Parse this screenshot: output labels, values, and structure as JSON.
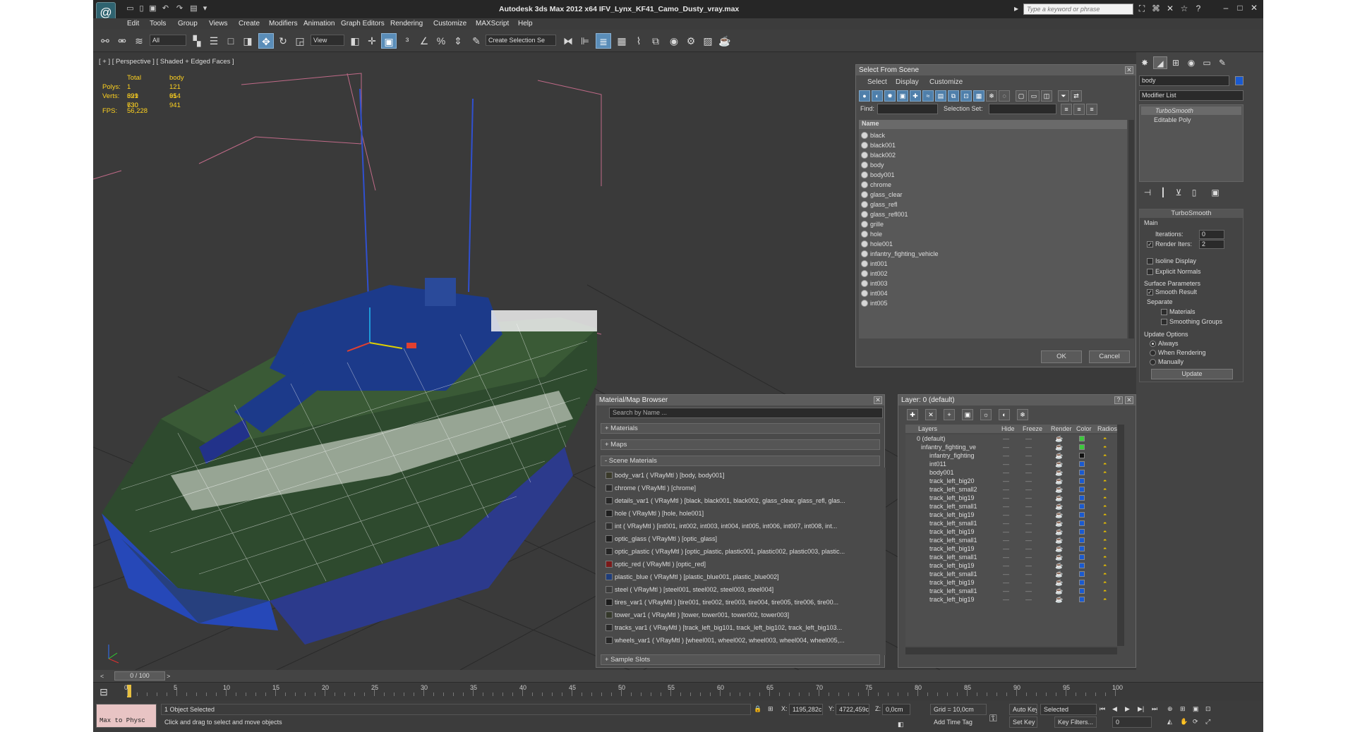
{
  "app": {
    "title": "Autodesk 3ds Max  2012 x64      IFV_Lynx_KF41_Camo_Dusty_vray.max",
    "search_placeholder": "Type a keyword or phrase",
    "logo_glyph": "@"
  },
  "menu": [
    "Edit",
    "Tools",
    "Group",
    "Views",
    "Create",
    "Modifiers",
    "Animation",
    "Graph Editors",
    "Rendering",
    "Customize",
    "MAXScript",
    "Help"
  ],
  "toolbar": {
    "filter": "All",
    "coord": "View",
    "selection_set": "Create Selection Se"
  },
  "viewport": {
    "label": "[ + ] [ Perspective ] [ Shaded + Edged Faces ]",
    "stats": {
      "header_total": "Total",
      "header_obj": "body",
      "polys_label": "Polys:",
      "polys_total": "1 321 630",
      "polys_obj": "121 914",
      "verts_label": "Verts:",
      "verts_total": "699 730",
      "verts_obj": "65 941",
      "fps_label": "FPS:",
      "fps_value": "56,228"
    }
  },
  "select_from_scene": {
    "title": "Select From Scene",
    "menu": [
      "Select",
      "Display",
      "Customize"
    ],
    "find_label": "Find:",
    "selection_set_label": "Selection Set:",
    "column": "Name",
    "items": [
      "black",
      "black001",
      "black002",
      "body",
      "body001",
      "chrome",
      "glass_clear",
      "glass_refl",
      "glass_refl001",
      "grille",
      "hole",
      "hole001",
      "infantry_fighting_vehicle",
      "int001",
      "int002",
      "int003",
      "int004",
      "int005"
    ],
    "ok": "OK",
    "cancel": "Cancel"
  },
  "material_browser": {
    "title": "Material/Map Browser",
    "search_placeholder": "Search by Name ...",
    "sections": [
      "+ Materials",
      "+ Maps",
      "- Scene Materials",
      "+ Sample Slots"
    ],
    "materials": [
      {
        "text": "body_var1  ( VRayMtl ) [body, body001]",
        "color": "#3a3a2a"
      },
      {
        "text": "chrome  ( VRayMtl ) [chrome]",
        "color": "#2b2b2b"
      },
      {
        "text": "details_var1  ( VRayMtl ) [black, black001, black002, glass_clear, glass_refl, glas...",
        "color": "#262626"
      },
      {
        "text": "hole  ( VRayMtl ) [hole, hole001]",
        "color": "#202020"
      },
      {
        "text": "int  ( VRayMtl ) [int001, int002, int003, int004, int005, int006, int007, int008, int...",
        "color": "#303030"
      },
      {
        "text": "optic_glass  ( VRayMtl ) [optic_glass]",
        "color": "#1e1e1e"
      },
      {
        "text": "optic_plastic  ( VRayMtl ) [optic_plastic, plastic001, plastic002, plastic003, plastic...",
        "color": "#252525"
      },
      {
        "text": "optic_red  ( VRayMtl ) [optic_red]",
        "color": "#7a1a1a"
      },
      {
        "text": "plastic_blue  ( VRayMtl ) [plastic_blue001, plastic_blue002]",
        "color": "#1f3d7a"
      },
      {
        "text": "steel  ( VRayMtl ) [steel001, steel002, steel003, steel004]",
        "color": "#3c3c3c"
      },
      {
        "text": "tires_var1  ( VRayMtl ) [tire001, tire002, tire003, tire004, tire005, tire006, tire00...",
        "color": "#1c1c1c"
      },
      {
        "text": "tower_var1  ( VRayMtl ) [tower, tower001, tower002, tower003]",
        "color": "#34382a"
      },
      {
        "text": "tracks_var1  ( VRayMtl ) [track_left_big101, track_left_big102, track_left_big103...",
        "color": "#2a2a2a"
      },
      {
        "text": "wheels_var1  ( VRayMtl ) [wheel001, wheel002, wheel003, wheel004, wheel005,...",
        "color": "#262626"
      }
    ]
  },
  "layers": {
    "title": "Layer: 0 (default)",
    "columns": [
      "Layers",
      "Hide",
      "Freeze",
      "Render",
      "Color",
      "Radios"
    ],
    "rows": [
      {
        "name": "0 (default)",
        "color": "#3cc83c"
      },
      {
        "name": "infantry_fighting_ve",
        "color": "#3cc83c"
      },
      {
        "name": "infantry_fighting",
        "color": "#111111"
      },
      {
        "name": "int011",
        "color": "#1a5ad0"
      },
      {
        "name": "body001",
        "color": "#1a5ad0"
      },
      {
        "name": "track_left_big20",
        "color": "#1a5ad0"
      },
      {
        "name": "track_left_small2",
        "color": "#1a5ad0"
      },
      {
        "name": "track_left_big19",
        "color": "#1a5ad0"
      },
      {
        "name": "track_left_small1",
        "color": "#1a5ad0"
      },
      {
        "name": "track_left_big19",
        "color": "#1a5ad0"
      },
      {
        "name": "track_left_small1",
        "color": "#1a5ad0"
      },
      {
        "name": "track_left_big19",
        "color": "#1a5ad0"
      },
      {
        "name": "track_left_small1",
        "color": "#1a5ad0"
      },
      {
        "name": "track_left_big19",
        "color": "#1a5ad0"
      },
      {
        "name": "track_left_small1",
        "color": "#1a5ad0"
      },
      {
        "name": "track_left_big19",
        "color": "#1a5ad0"
      },
      {
        "name": "track_left_small1",
        "color": "#1a5ad0"
      },
      {
        "name": "track_left_big19",
        "color": "#1a5ad0"
      },
      {
        "name": "track_left_small1",
        "color": "#1a5ad0"
      },
      {
        "name": "track_left_big19",
        "color": "#1a5ad0"
      }
    ]
  },
  "command_panel": {
    "object_name": "body",
    "modifier_list": "Modifier List",
    "stack": [
      "TurboSmooth",
      "Editable Poly"
    ],
    "rollout_title": "TurboSmooth",
    "main_label": "Main",
    "iterations_label": "Iterations:",
    "iterations": "0",
    "render_iters_label": "Render Iters:",
    "render_iters": "2",
    "isoline": "Isoline Display",
    "explicit_normals": "Explicit Normals",
    "surface_params": "Surface Parameters",
    "smooth_result": "Smooth Result",
    "separate": "Separate",
    "materials": "Materials",
    "smoothing_groups": "Smoothing Groups",
    "update_options": "Update Options",
    "always": "Always",
    "when_rendering": "When Rendering",
    "manually": "Manually",
    "update": "Update"
  },
  "timeline": {
    "frame": "0 / 100",
    "ticks": [
      "0",
      "5",
      "10",
      "15",
      "20",
      "25",
      "30",
      "35",
      "40",
      "45",
      "50",
      "55",
      "60",
      "65",
      "70",
      "75",
      "80",
      "85",
      "90",
      "95",
      "100"
    ]
  },
  "status": {
    "maxscript": "Max to Physc",
    "selected": "1 Object Selected",
    "prompt": "Click and drag to select and move objects",
    "x_label": "X:",
    "x": "1195,282c",
    "y_label": "Y:",
    "y": "4722,459c",
    "z_label": "Z:",
    "z": "0,0cm",
    "grid": "Grid = 10,0cm",
    "add_time_tag": "Add Time Tag",
    "auto_key": "Auto Key",
    "set_key": "Set Key",
    "key_mode": "Selected",
    "key_filters": "Key Filters...",
    "frame_field": "0"
  }
}
